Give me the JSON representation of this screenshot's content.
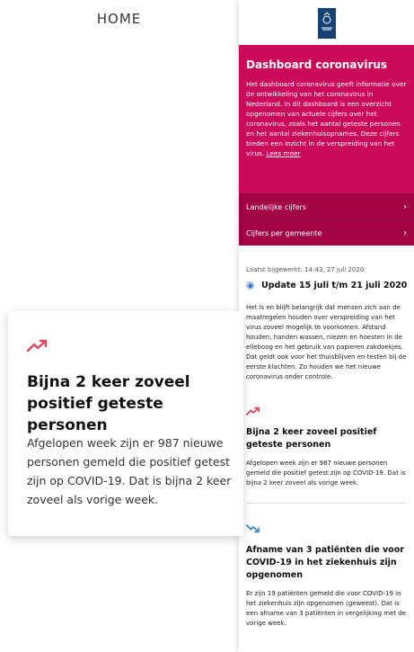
{
  "home_label": "HOME",
  "zoom_card": {
    "icon": "trend-up-icon",
    "title": "Bijna 2 keer zoveel positief geteste personen",
    "text": "Afgelopen week zijn er 987 nieuwe personen gemeld die positief getest zijn op COVID-19. Dat is bijna 2 keer zoveel als vorige week."
  },
  "phone": {
    "logo": "rijksoverheid-crest",
    "hero": {
      "title": "Dashboard coronavirus",
      "text": "Het dashboard coronavirus geeft informatie over de ontwikkeling van het coronavirus in Nederland. In dit dashboard is een overzicht opgenomen van actuele cijfers over het coronavirus, zoals het aantal geteste personen en het aantal ziekenhuisopnames. Deze cijfers bieden een inzicht in de verspreiding van het virus.",
      "link": "Lees meer"
    },
    "nav": [
      {
        "label": "Landelijke cijfers"
      },
      {
        "label": "Cijfers per gemeente"
      }
    ],
    "updated": "Laatst bijgewerkt: 14:43, 27 juli 2020",
    "update_title": "Update 15 juli t/m 21 juli 2020",
    "update_text": "Het is en blijft belangrijk dat mensen zich aan de maatregelen houden over verspreiding van het virus zoveel mogelijk te voorkomen. Afstand houden, handen wassen, niezen en hoesten in de elleboog en het gebruik van papieren zakdoekjes. Dat geldt ook voor het thuisblijven en testen bij de eerste klachten. Zo houden we het nieuwe coronavirus onder controle.",
    "cards": [
      {
        "icon": "trend-up-icon",
        "title": "Bijna 2 keer zoveel positief geteste personen",
        "text": "Afgelopen week zijn er 987 nieuwe personen gemeld die positief getest zijn op COVID-19. Dat is bijna 2 keer zoveel als vorige week."
      },
      {
        "icon": "trend-down-icon",
        "title": "Afname van 3 patiënten die voor COVID-19 in het ziekenhuis zijn opgenomen",
        "text": "Er zijn 19 patiënten gemeld die voor COVID-19 in het ziekenhuis zijn opgenomen (geweest). Dat is een afname van 3 patiënten in vergelijking met de vorige week."
      }
    ],
    "colors": {
      "hero": "#cc0a5a",
      "nav": "#a30446",
      "up": "#e0475f",
      "down": "#3d86c6"
    }
  }
}
